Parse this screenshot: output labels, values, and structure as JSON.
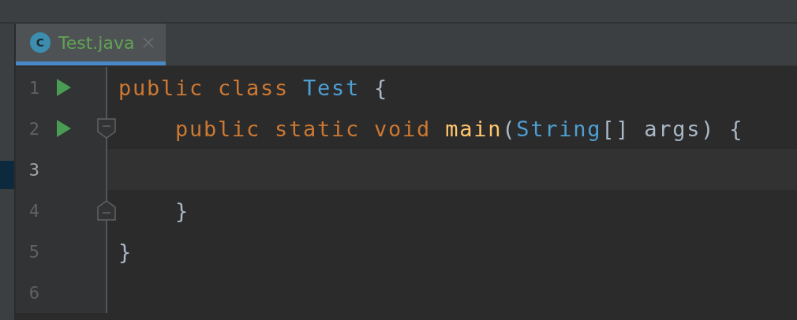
{
  "tabs": [
    {
      "label": "Test.java",
      "selected": true,
      "icon": "C"
    }
  ],
  "lines": [
    {
      "number": "1",
      "run": true,
      "fold_start": false,
      "fold_end": false,
      "current": false,
      "tokens": [
        {
          "kind": "keyword",
          "text": "public class "
        },
        {
          "kind": "class",
          "text": "Test "
        },
        {
          "kind": "plain",
          "text": "{"
        }
      ]
    },
    {
      "number": "2",
      "run": true,
      "fold_start": true,
      "fold_end": false,
      "current": false,
      "tokens": [
        {
          "kind": "keyword",
          "text": "    public static void "
        },
        {
          "kind": "method",
          "text": "main"
        },
        {
          "kind": "plain",
          "text": "("
        },
        {
          "kind": "class",
          "text": "String"
        },
        {
          "kind": "plain",
          "text": "[] args) {"
        }
      ]
    },
    {
      "number": "3",
      "run": false,
      "fold_start": false,
      "fold_end": false,
      "current": true
    },
    {
      "number": "4",
      "run": false,
      "fold_start": false,
      "fold_end": true,
      "current": false,
      "tokens": [
        {
          "kind": "plain",
          "text": "    }"
        }
      ]
    },
    {
      "number": "5",
      "run": false,
      "fold_start": false,
      "fold_end": false,
      "current": false,
      "tokens": [
        {
          "kind": "plain",
          "text": "}"
        }
      ]
    },
    {
      "number": "6",
      "run": false,
      "fold_start": false,
      "fold_end": false,
      "current": false
    }
  ]
}
